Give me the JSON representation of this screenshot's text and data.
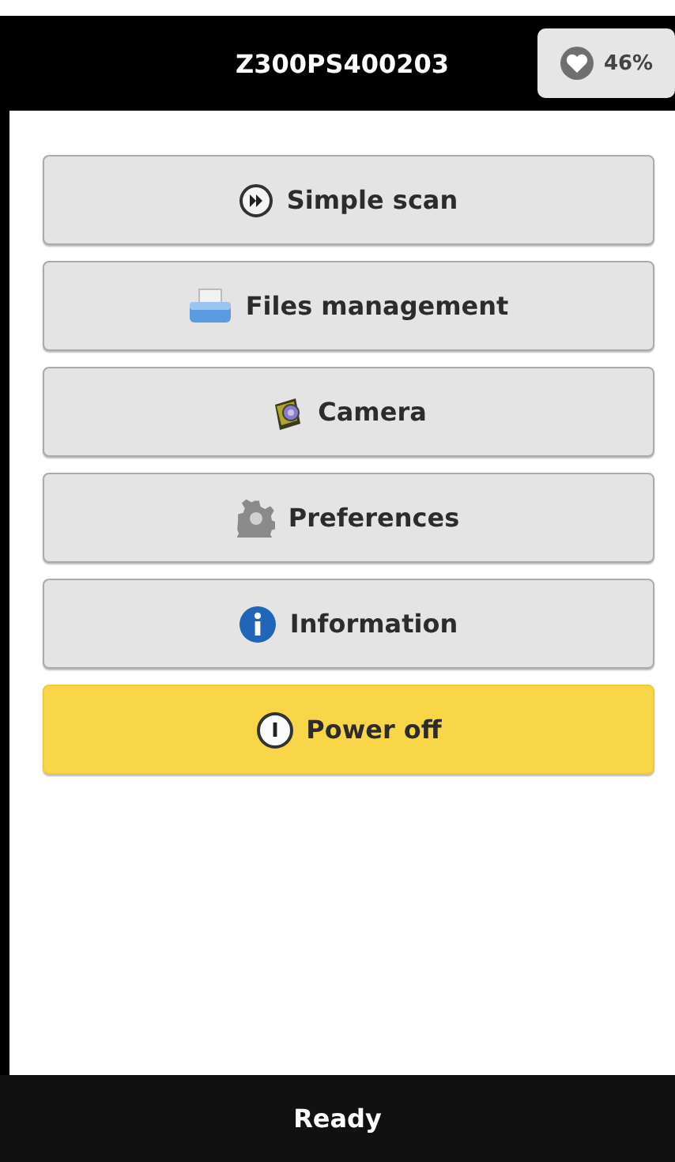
{
  "header": {
    "title": "Z300PS400203",
    "battery": "46%"
  },
  "menu": [
    {
      "label": "Simple scan",
      "kind": "scan"
    },
    {
      "label": "Files management",
      "kind": "files"
    },
    {
      "label": "Camera",
      "kind": "camera"
    },
    {
      "label": "Preferences",
      "kind": "preferences"
    },
    {
      "label": "Information",
      "kind": "information"
    },
    {
      "label": "Power off",
      "kind": "power"
    }
  ],
  "status_bar": {
    "text": "Ready"
  }
}
